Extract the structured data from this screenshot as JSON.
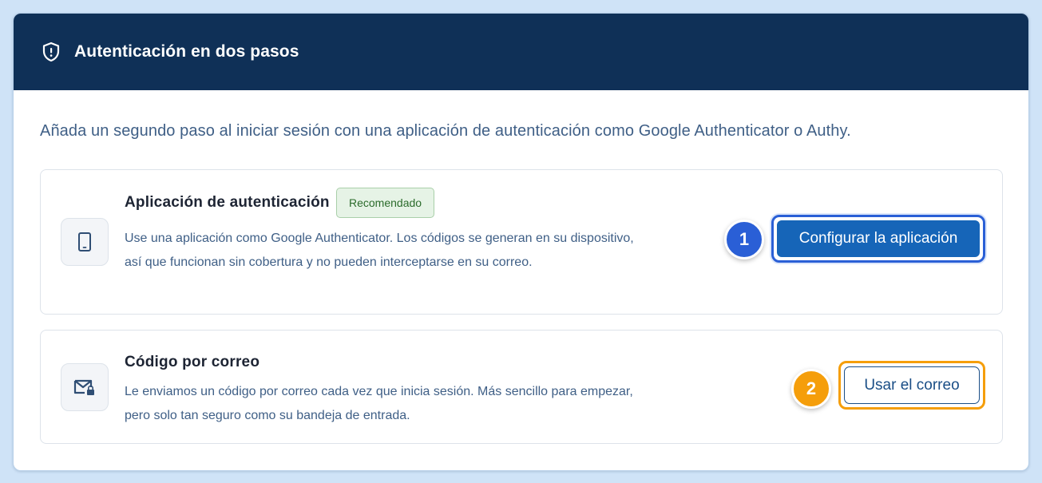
{
  "header": {
    "title": "Autenticación en dos pasos",
    "icon": "shield-icon"
  },
  "intro": "Añada un segundo paso al iniciar sesión con una aplicación de autenticación como Google Authenticator o Authy.",
  "options": [
    {
      "icon": "smartphone-icon",
      "title": "Aplicación de autenticación",
      "badge": "Recomendado",
      "description": "Use una aplicación como Google Authenticator. Los códigos se generan en su dispositivo, así que funcionan sin cobertura y no pueden interceptarse en su correo.",
      "step": "1",
      "button_label": "Configurar la aplicación"
    },
    {
      "icon": "mail-lock-icon",
      "title": "Código por correo",
      "description": "Le enviamos un código por correo cada vez que inicia sesión. Más sencillo para empezar, pero solo tan seguro como su bandeja de entrada.",
      "step": "2",
      "button_label": "Usar el correo"
    }
  ],
  "colors": {
    "header_bg": "#0f3057",
    "primary": "#1665b8",
    "step1": "#2a5fd6",
    "step2": "#f59e0b",
    "badge_bg": "#e6f3e6",
    "text_muted": "#3f5f86"
  }
}
